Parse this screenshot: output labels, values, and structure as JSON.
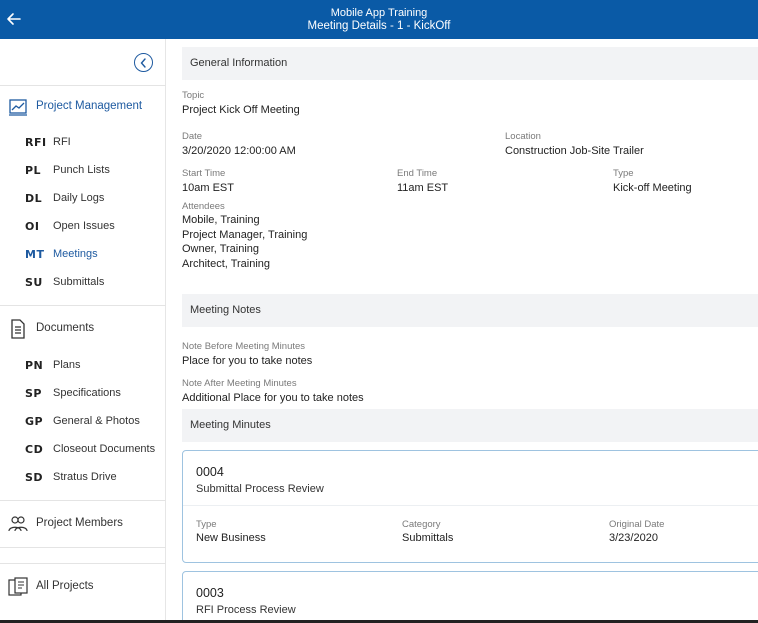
{
  "header": {
    "app_title": "Mobile App Training",
    "page_title": "Meeting Details - 1 - KickOff"
  },
  "sidebar": {
    "sections": [
      {
        "label": "Project Management",
        "icon": "chart-icon",
        "active": true
      },
      {
        "label": "Documents",
        "icon": "document-icon"
      },
      {
        "label": "Project Members",
        "icon": "people-icon"
      },
      {
        "label": "All Projects",
        "icon": "projects-icon"
      }
    ],
    "pm_items": [
      {
        "abbr": "RFI",
        "label": "RFI"
      },
      {
        "abbr": "PL",
        "label": "Punch Lists"
      },
      {
        "abbr": "DL",
        "label": "Daily Logs"
      },
      {
        "abbr": "OI",
        "label": "Open Issues"
      },
      {
        "abbr": "MT",
        "label": "Meetings"
      },
      {
        "abbr": "SU",
        "label": "Submittals"
      }
    ],
    "doc_items": [
      {
        "abbr": "PN",
        "label": "Plans"
      },
      {
        "abbr": "SP",
        "label": "Specifications"
      },
      {
        "abbr": "GP",
        "label": "General & Photos"
      },
      {
        "abbr": "CD",
        "label": "Closeout Documents"
      },
      {
        "abbr": "SD",
        "label": "Stratus Drive"
      }
    ]
  },
  "general": {
    "heading": "General Information",
    "topic_label": "Topic",
    "topic": "Project Kick Off Meeting",
    "date_label": "Date",
    "date": "3/20/2020 12:00:00 AM",
    "location_label": "Location",
    "location": "Construction Job-Site Trailer",
    "start_label": "Start Time",
    "start": "10am EST",
    "end_label": "End Time",
    "end": "11am EST",
    "type_label": "Type",
    "type": "Kick-off Meeting",
    "attendees_label": "Attendees",
    "attendees": [
      "Mobile, Training",
      "Project Manager, Training",
      "Owner, Training",
      "Architect, Training"
    ]
  },
  "notes": {
    "heading": "Meeting Notes",
    "before_label": "Note Before Meeting Minutes",
    "before": "Place for you to take notes",
    "after_label": "Note After Meeting Minutes",
    "after": "Additional Place for you to take notes"
  },
  "minutes": {
    "heading": "Meeting Minutes",
    "items": [
      {
        "number": "0004",
        "title": "Submittal Process Review",
        "type_label": "Type",
        "type": "New Business",
        "category_label": "Category",
        "category": "Submittals",
        "date_label": "Original Date",
        "date": "3/23/2020"
      },
      {
        "number": "0003",
        "title": "RFI Process Review"
      }
    ]
  },
  "colors": {
    "header_bg": "#0a5aa6",
    "accent": "#1e5aa0"
  }
}
